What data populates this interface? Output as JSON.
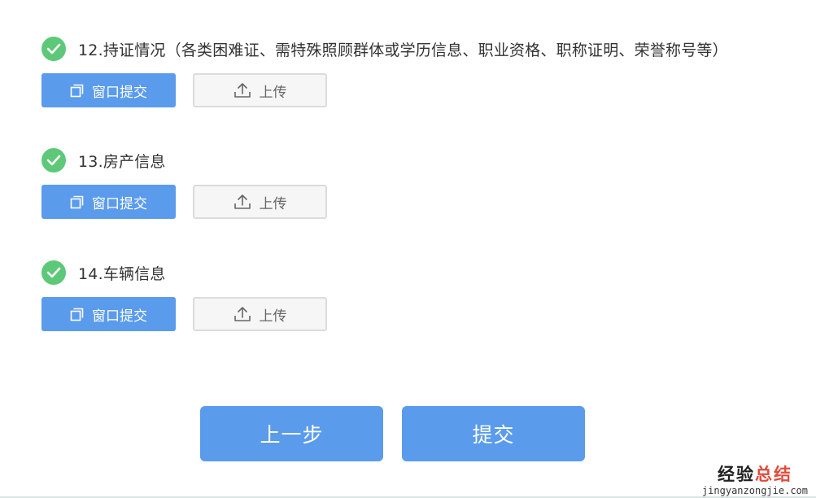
{
  "sections": [
    {
      "label": "12.持证情况（各类困难证、需特殊照顾群体或学历信息、职业资格、职称证明、荣誉称号等）",
      "window_submit_label": "窗口提交",
      "upload_label": "上传",
      "status_icon": "check-circle-icon"
    },
    {
      "label": "13.房产信息",
      "window_submit_label": "窗口提交",
      "upload_label": "上传",
      "status_icon": "check-circle-icon"
    },
    {
      "label": "14.车辆信息",
      "window_submit_label": "窗口提交",
      "upload_label": "上传",
      "status_icon": "check-circle-icon"
    }
  ],
  "footer": {
    "prev_label": "上一步",
    "submit_label": "提交"
  },
  "watermark": {
    "part1": "经验",
    "part2": "总结",
    "url": "jingyanzongjie.com"
  },
  "colors": {
    "primary": "#5b9bec",
    "check": "#5ec879",
    "upload_bg": "#f6f6f6",
    "upload_border": "#dcdcdc",
    "text": "#333333",
    "watermark_accent": "#e14b3b"
  }
}
